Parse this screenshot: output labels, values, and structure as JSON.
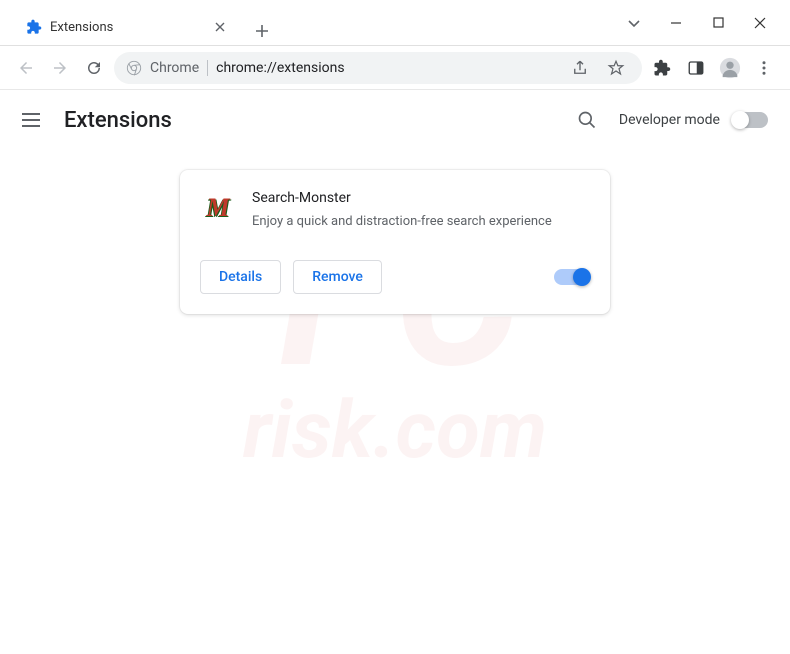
{
  "tab": {
    "title": "Extensions"
  },
  "addressbar": {
    "scheme_label": "Chrome",
    "url": "chrome://extensions"
  },
  "page": {
    "title": "Extensions",
    "developer_mode_label": "Developer mode"
  },
  "extension": {
    "name": "Search-Monster",
    "description": "Enjoy a quick and distraction-free search experience",
    "icon_letter": "M",
    "details_label": "Details",
    "remove_label": "Remove",
    "enabled": true
  },
  "watermark": {
    "line1": "PC",
    "line2": "risk.com"
  }
}
